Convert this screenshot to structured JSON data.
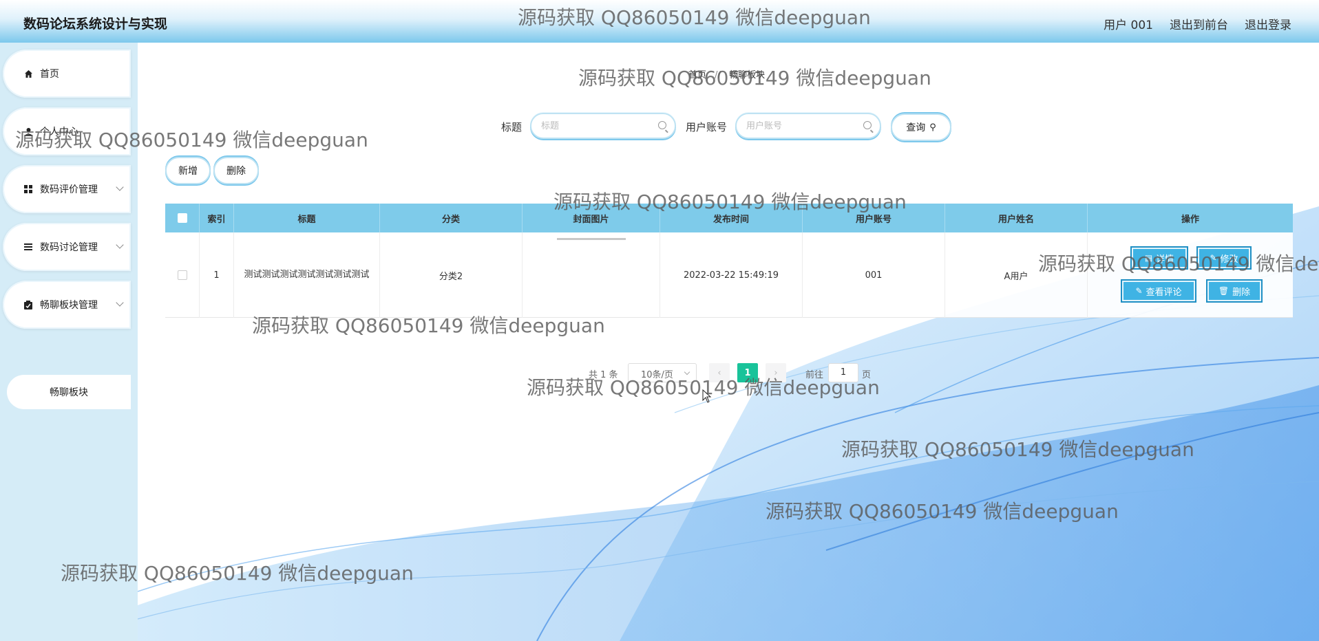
{
  "app": {
    "title": "数码论坛系统设计与实现"
  },
  "header": {
    "links": [
      "用户 001",
      "退出到前台",
      "退出登录"
    ]
  },
  "sidebar": {
    "items": [
      {
        "label": "首页",
        "icon": "home-icon"
      },
      {
        "label": "个人中心",
        "icon": "user-icon"
      },
      {
        "label": "数码评价管理",
        "icon": "grid-icon"
      },
      {
        "label": "数码讨论管理",
        "icon": "list-icon"
      },
      {
        "label": "畅聊板块管理",
        "icon": "clipboard-icon"
      }
    ],
    "sub_item": "畅聊板块"
  },
  "breadcrumb": {
    "home": "首页",
    "separator": "//",
    "current": "畅聊板块"
  },
  "search": {
    "title_label": "标题",
    "title_placeholder": "标题",
    "account_label": "用户账号",
    "account_placeholder": "用户账号",
    "query_button": "查询"
  },
  "actions": {
    "add": "新增",
    "delete": "删除"
  },
  "table": {
    "headers": [
      "索引",
      "标题",
      "分类",
      "封面图片",
      "发布时间",
      "用户账号",
      "用户姓名",
      "操作"
    ],
    "rows": [
      {
        "index": "1",
        "title": "测试测试测试测试测试测试测试",
        "category": "分类2",
        "cover": "",
        "time": "2022-03-22 15:49:19",
        "account": "001",
        "name": "A用户",
        "ops": {
          "detail": "详情",
          "edit": "修改",
          "comments": "查看评论",
          "delete": "删除"
        }
      }
    ]
  },
  "pagination": {
    "total": "共 1 条",
    "page_size": "10条/页",
    "current_page": "1",
    "goto_label": "前往",
    "goto_value": "1",
    "page_unit": "页"
  },
  "watermark": {
    "text": "源码获取 QQ86050149 微信deepguan"
  },
  "colors": {
    "header_blue": "#7cc8ec",
    "table_header": "#7ecbea",
    "button_blue": "#3fb3e4",
    "active_page": "#19c39a",
    "sidebar_bg": "#d5ecf7"
  }
}
